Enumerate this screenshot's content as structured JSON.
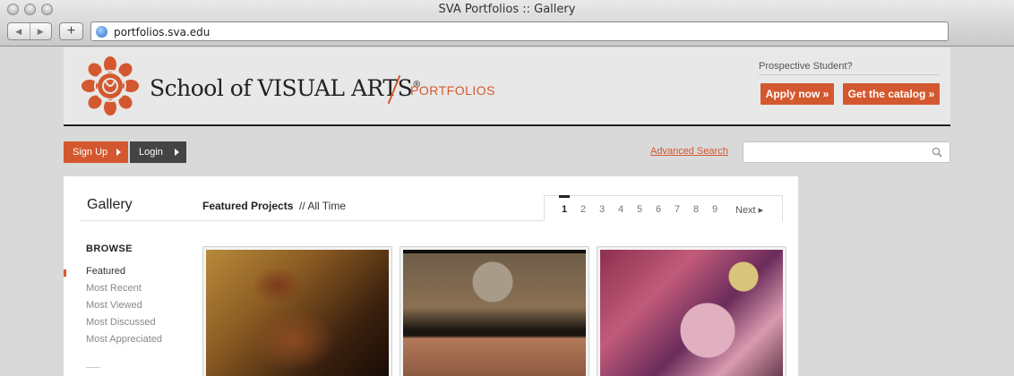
{
  "browser": {
    "window_title": "SVA Portfolios :: Gallery",
    "url": "portfolios.sva.edu",
    "back_glyph": "◀",
    "forward_glyph": "▶",
    "add_glyph": "+"
  },
  "header": {
    "school_name": "School of VISUAL ARTS",
    "registered_mark": "®",
    "section": "PORTFOLIOS",
    "prospective": "Prospective Student?",
    "apply_button": "Apply now »",
    "catalog_button": "Get the catalog »"
  },
  "account": {
    "signup": "Sign Up",
    "login": "Login",
    "advanced_search": "Advanced Search",
    "search_placeholder": ""
  },
  "gallery": {
    "title": "Gallery",
    "featured": "Featured Projects",
    "timeframe": "// All Time",
    "pages": [
      "1",
      "2",
      "3",
      "4",
      "5",
      "6",
      "7",
      "8",
      "9"
    ],
    "current_page": "1",
    "next": "Next ▸",
    "browse_heading": "BROWSE",
    "browse_items": [
      "Featured",
      "Most Recent",
      "Most Viewed",
      "Most Discussed",
      "Most Appreciated"
    ],
    "selected_browse": "Featured"
  },
  "colors": {
    "accent": "#d4582f",
    "dark_button": "#444444",
    "background": "#d9d9d9"
  }
}
